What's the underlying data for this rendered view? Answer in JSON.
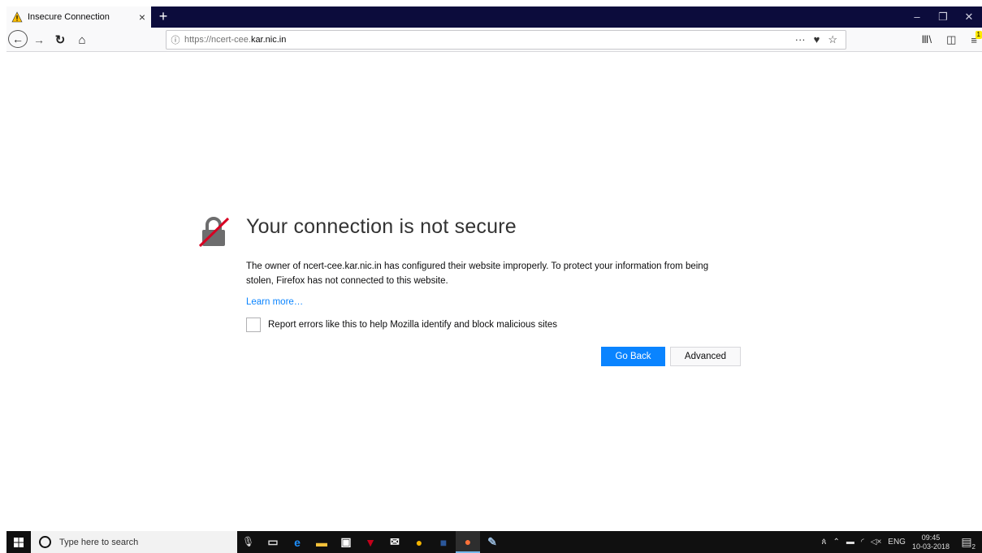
{
  "tab": {
    "title": "Insecure Connection",
    "close": "×",
    "new_tab": "+"
  },
  "window_controls": {
    "minimize": "–",
    "restore": "❐",
    "close": "✕"
  },
  "nav": {
    "back": "←",
    "forward": "→",
    "reload": "↻",
    "home": "⌂",
    "url_info": "ⓘ",
    "url_prefix": "https://ncert-cee.",
    "url_host": "kar.nic.in",
    "page_actions": "···",
    "pocket": "♥",
    "bookmark": "☆",
    "library": "Ⅲ\\",
    "sidebar": "◫",
    "menu": "≡",
    "menu_badge": "1"
  },
  "error": {
    "title": "Your connection is not secure",
    "description": "The owner of ncert-cee.kar.nic.in has configured their website improperly. To protect your information from being stolen, Firefox has not connected to this website.",
    "learn_more": "Learn more…",
    "report_label": "Report errors like this to help Mozilla identify and block malicious sites",
    "go_back": "Go Back",
    "advanced": "Advanced"
  },
  "taskbar": {
    "search_placeholder": "Type here to search",
    "mic": "🎙",
    "tray_lang": "ENG",
    "time": "09:45",
    "date": "10-03-2018",
    "notif_count": "2"
  },
  "colors": {
    "accent": "#0a84ff",
    "titlebar": "#0c0c3c",
    "taskbar": "#101010"
  }
}
